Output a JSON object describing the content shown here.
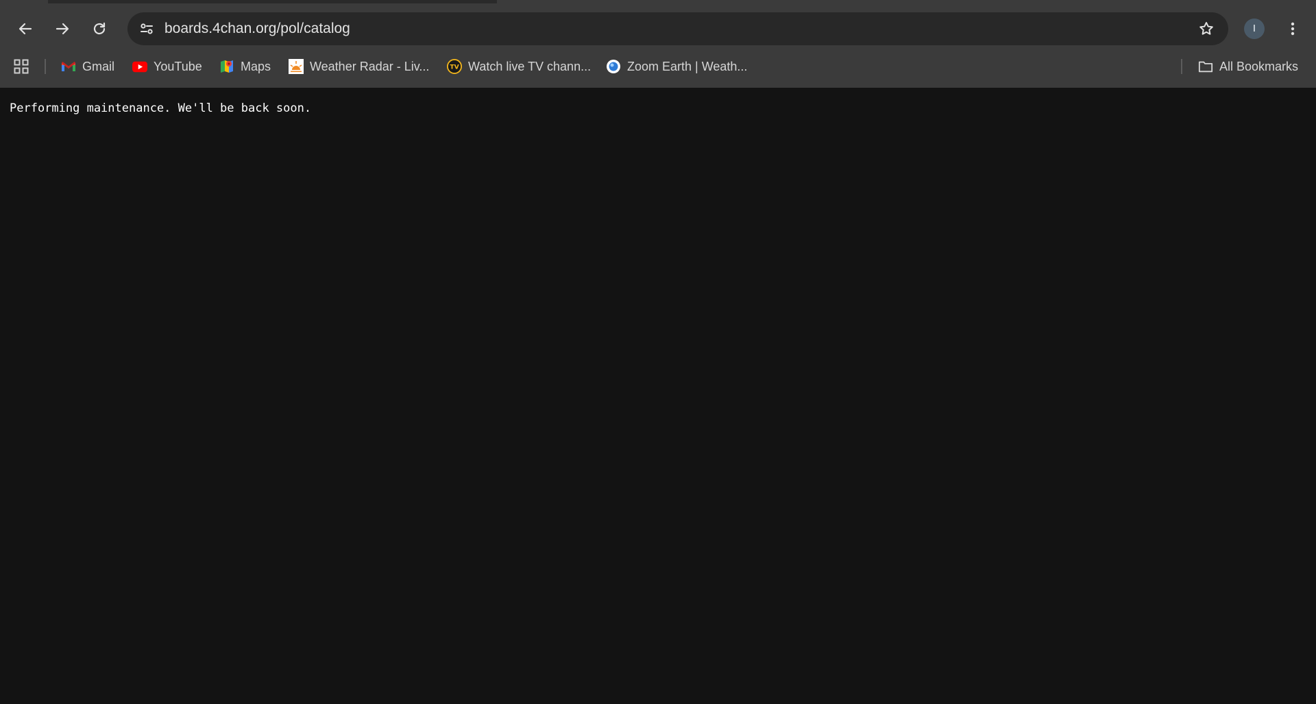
{
  "browser": {
    "url": "boards.4chan.org/pol/catalog",
    "profile_initial": "I",
    "colors": {
      "toolbar": "#3b3b3b",
      "omnibox": "#282828",
      "page_background": "#131313",
      "text": "#e3e3e3"
    },
    "icons": {
      "back": "arrow-left",
      "forward": "arrow-right",
      "reload": "circular-arrow",
      "site_info": "tune-sliders",
      "bookmark_star": "star-outline",
      "menu": "three-vertical-dots"
    }
  },
  "bookmarks": {
    "items": [
      {
        "label": "Gmail",
        "icon": "gmail-icon"
      },
      {
        "label": "YouTube",
        "icon": "youtube-icon"
      },
      {
        "label": "Maps",
        "icon": "maps-icon"
      },
      {
        "label": "Weather Radar - Liv...",
        "icon": "weather-radar-icon"
      },
      {
        "label": "Watch live TV chann...",
        "icon": "tv-icon"
      },
      {
        "label": "Zoom Earth | Weath...",
        "icon": "zoom-earth-icon"
      }
    ],
    "all_bookmarks_label": "All Bookmarks"
  },
  "page": {
    "message": "Performing maintenance. We'll be back soon."
  }
}
